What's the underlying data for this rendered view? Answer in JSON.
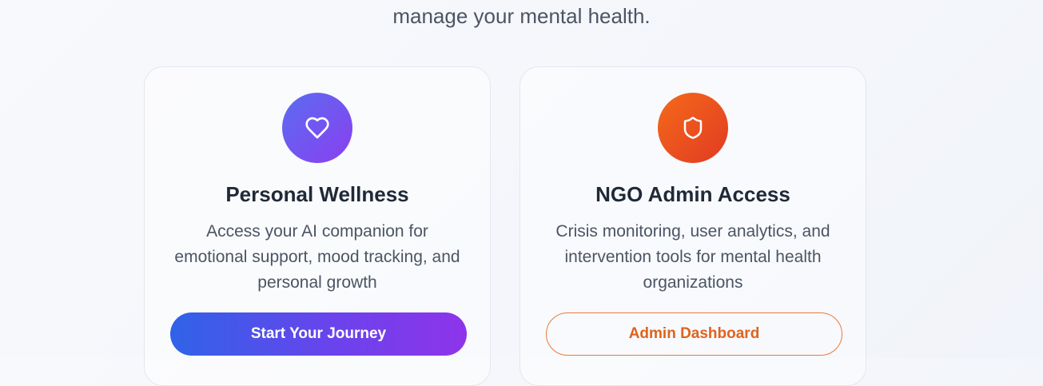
{
  "intro": {
    "text": "manage your mental health."
  },
  "cards": [
    {
      "icon": "heart-icon",
      "title": "Personal Wellness",
      "description": "Access your AI companion for emotional support, mood tracking, and personal growth",
      "button_label": "Start Your Journey"
    },
    {
      "icon": "shield-icon",
      "title": "NGO Admin Access",
      "description": "Crisis monitoring, user analytics, and intervention tools for mental health organizations",
      "button_label": "Admin Dashboard"
    }
  ],
  "colors": {
    "personal_gradient_start": "#5b6cf0",
    "personal_gradient_end": "#8a3ff0",
    "admin_gradient_start": "#f46a1a",
    "admin_gradient_end": "#e23a23",
    "primary_button_start": "#2f63e8",
    "primary_button_end": "#8e34ea",
    "admin_outline": "#ea7a3c"
  }
}
